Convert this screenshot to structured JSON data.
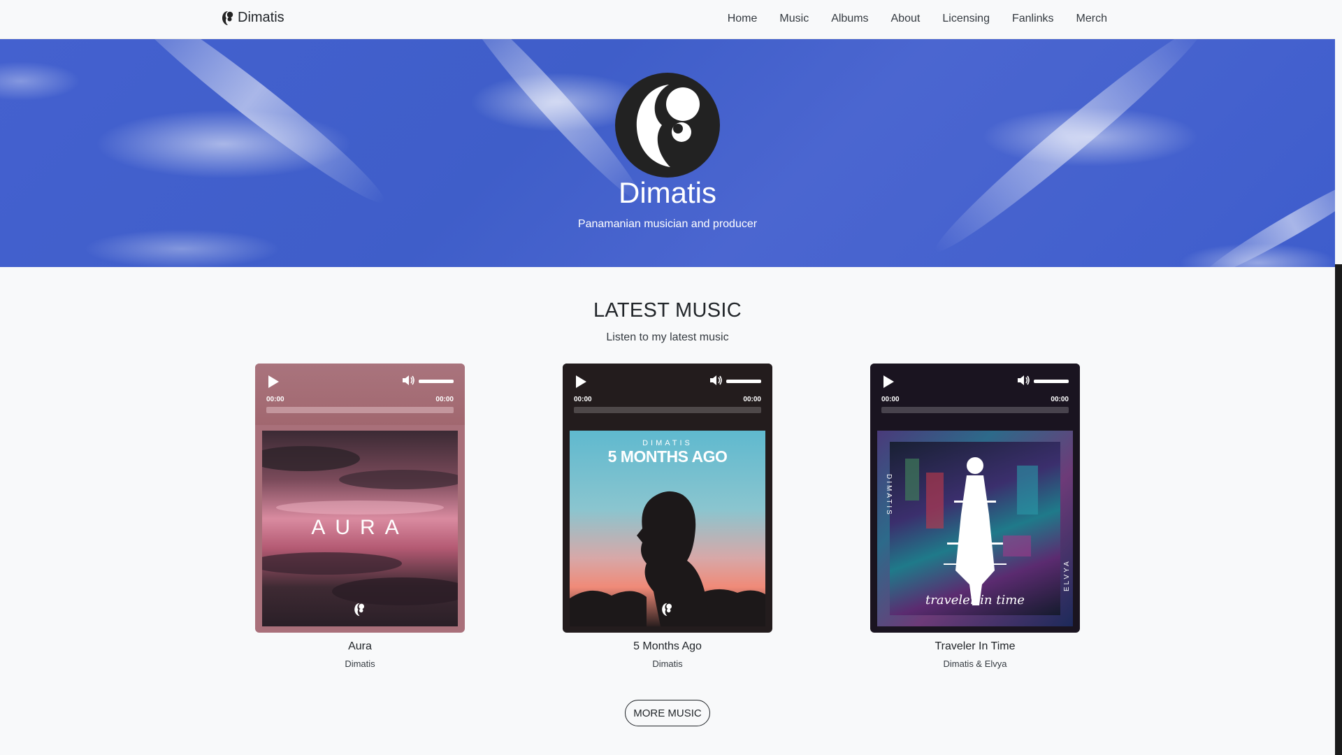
{
  "brand": {
    "name": "Dimatis",
    "icon": "dimatis-logo-icon"
  },
  "nav": {
    "items": [
      {
        "label": "Home"
      },
      {
        "label": "Music"
      },
      {
        "label": "Albums"
      },
      {
        "label": "About"
      },
      {
        "label": "Licensing"
      },
      {
        "label": "Fanlinks"
      },
      {
        "label": "Merch"
      }
    ]
  },
  "hero": {
    "title": "Dimatis",
    "subtitle": "Panamanian musician and producer",
    "bg_color": "#4461cf"
  },
  "latest": {
    "title": "LATEST MUSIC",
    "subtitle": "Listen to my latest music",
    "tracks": [
      {
        "title": "Aura",
        "artist": "Dimatis",
        "elapsed": "00:00",
        "duration": "00:00",
        "cover_text": "AURA",
        "player_color": "#a9707a",
        "progress": 0
      },
      {
        "title": "5 Months Ago",
        "artist": "Dimatis",
        "elapsed": "00:00",
        "duration": "00:00",
        "cover_top": "DIMATIS",
        "cover_text": "5 MONTHS AGO",
        "player_color": "#231c1d",
        "progress": 0
      },
      {
        "title": "Traveler In Time",
        "artist": "Dimatis & Elvya",
        "elapsed": "00:00",
        "duration": "00:00",
        "cover_left": "DIMATIS",
        "cover_right": "ELVYA",
        "cover_text": "traveler in time",
        "player_color": "#1a1420",
        "progress": 0
      }
    ],
    "more_label": "MORE MUSIC"
  }
}
